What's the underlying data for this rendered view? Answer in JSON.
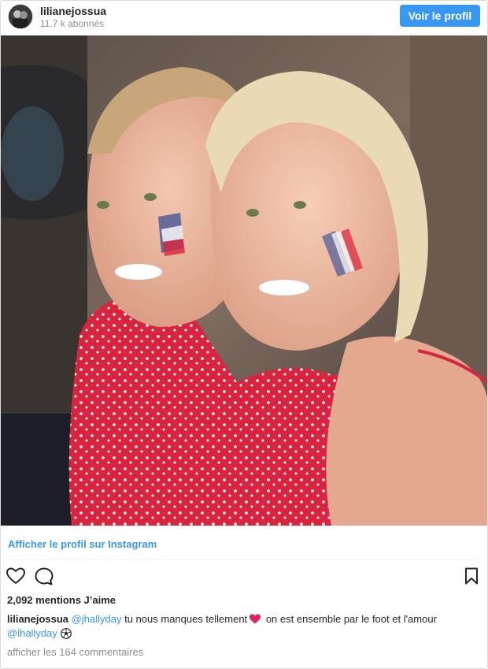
{
  "header": {
    "username": "lilianejossua",
    "followers": "11.7 k abonnés",
    "view_profile_button": "Voir le profil"
  },
  "photo": {
    "description_icon": "photo-image"
  },
  "view_on_instagram": "Afficher le profil sur Instagram",
  "actions": {
    "like_icon": "heart-outline-icon",
    "comment_icon": "comment-icon",
    "save_icon": "bookmark-icon"
  },
  "likes": "2,092 mentions J’aime",
  "caption": {
    "username": "lilianejossua",
    "mention1": "@jhallyday",
    "text1": "tu nous manques tellement",
    "text2": "on est ensemble par le foot et l'amour",
    "mention2": "@lhallyday"
  },
  "comments_link": "afficher les 164 commentaires",
  "colors": {
    "accent": "#3897f0",
    "text": "#262626",
    "muted": "#8e8e8e",
    "heart": "#e0245e"
  }
}
